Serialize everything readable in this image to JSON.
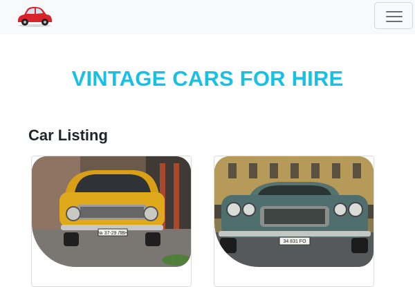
{
  "navbar": {
    "brand": {
      "icon": "red-vintage-car-logo",
      "color": "#d8232a"
    },
    "toggle_icon": "hamburger-icon"
  },
  "hero": {
    "title": "VINTAGE CARS FOR HIRE",
    "color": "#17c1e6"
  },
  "listing": {
    "title": "Car Listing",
    "cards": [
      {
        "image": "yellow-vintage-sedan-photo",
        "car_color": "#e0a91b",
        "plate": "№ 37-29 ЛВН"
      },
      {
        "image": "teal-vintage-coupe-photo",
        "car_color": "#4e6f6d",
        "plate": "34 831 FO"
      }
    ]
  }
}
